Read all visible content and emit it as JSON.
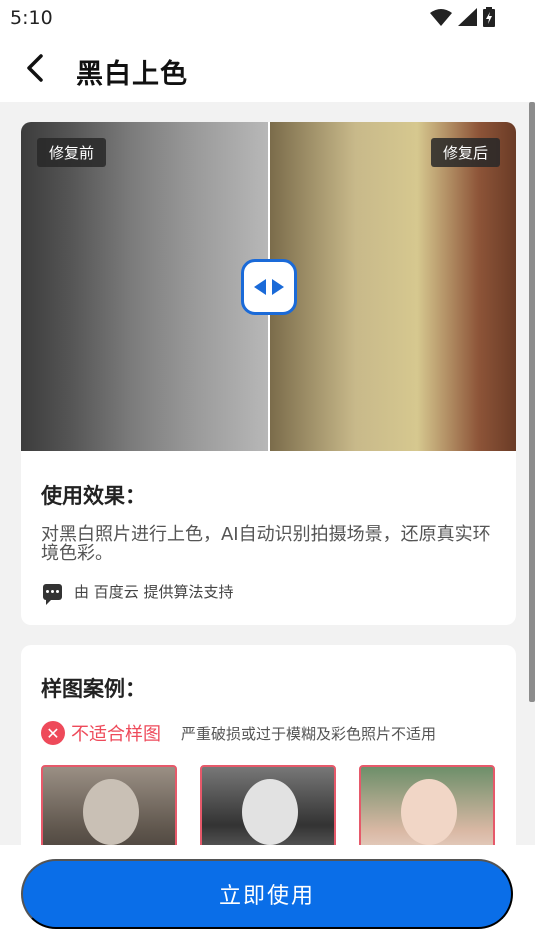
{
  "status": {
    "time": "5:10",
    "wifi_icon": "wifi-icon",
    "signal_icon": "signal-icon",
    "battery_icon": "battery-charging-icon"
  },
  "header": {
    "title": "黑白上色",
    "back_icon": "back-arrow-icon"
  },
  "compare": {
    "before_label": "修复前",
    "after_label": "修复后",
    "handle_icon": "compare-slider-handle-icon",
    "split_fraction": 0.5
  },
  "effect": {
    "title": "使用效果：",
    "description": "对黑白照片进行上色，AI自动识别拍摄场景，还原真实环境色彩。",
    "powered_by": "由 百度云 提供算法支持"
  },
  "samples": {
    "title": "样图案例：",
    "unsuitable_label": "不适合样图",
    "unsuitable_note": "严重破损或过于模糊及彩色照片不适用",
    "items": [
      "sample-damaged-photo",
      "sample-blurry-photo",
      "sample-color-photo"
    ]
  },
  "cta": {
    "label": "立即使用"
  },
  "colors": {
    "primary": "#0a6ee8",
    "warning": "#ee4a5a",
    "background": "#f2f2f2"
  }
}
